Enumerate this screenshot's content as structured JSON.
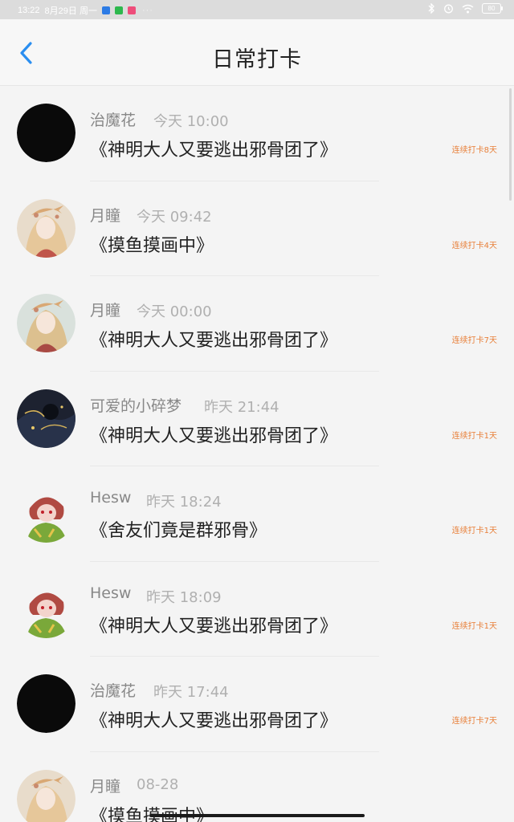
{
  "status_bar": {
    "time": "13:22",
    "date": "8月29日 周一",
    "battery": "80"
  },
  "nav": {
    "title": "日常打卡",
    "back_icon": "chevron-left-icon"
  },
  "colors": {
    "accent_blue": "#2a8ef0",
    "streak_orange": "#e8803a"
  },
  "items": [
    {
      "user": "治魔花",
      "time": "今天 10:00",
      "book": "《神明大人又要逃出邪骨团了》",
      "streak": "连续打卡8天",
      "avatar": "black"
    },
    {
      "user": "月瞳",
      "time": "今天 09:42",
      "book": "《摸鱼摸画中》",
      "streak": "连续打卡4天",
      "avatar": "anime-girl"
    },
    {
      "user": "月瞳",
      "time": "今天 00:00",
      "book": "《神明大人又要逃出邪骨团了》",
      "streak": "连续打卡7天",
      "avatar": "anime-girl"
    },
    {
      "user": "可爱的小碎梦",
      "time": "昨天 21:44",
      "book": "《神明大人又要逃出邪骨团了》",
      "streak": "连续打卡1天",
      "avatar": "dark-art"
    },
    {
      "user": "Hesw",
      "time": "昨天 18:24",
      "book": "《舍友们竟是群邪骨》",
      "streak": "连续打卡1天",
      "avatar": "red-hair"
    },
    {
      "user": "Hesw",
      "time": "昨天 18:09",
      "book": "《神明大人又要逃出邪骨团了》",
      "streak": "连续打卡1天",
      "avatar": "red-hair"
    },
    {
      "user": "治魔花",
      "time": "昨天 17:44",
      "book": "《神明大人又要逃出邪骨团了》",
      "streak": "连续打卡7天",
      "avatar": "black"
    },
    {
      "user": "月瞳",
      "time": "08-28",
      "book": "《摸鱼摸画中》",
      "streak": "",
      "avatar": "anime-girl"
    }
  ]
}
